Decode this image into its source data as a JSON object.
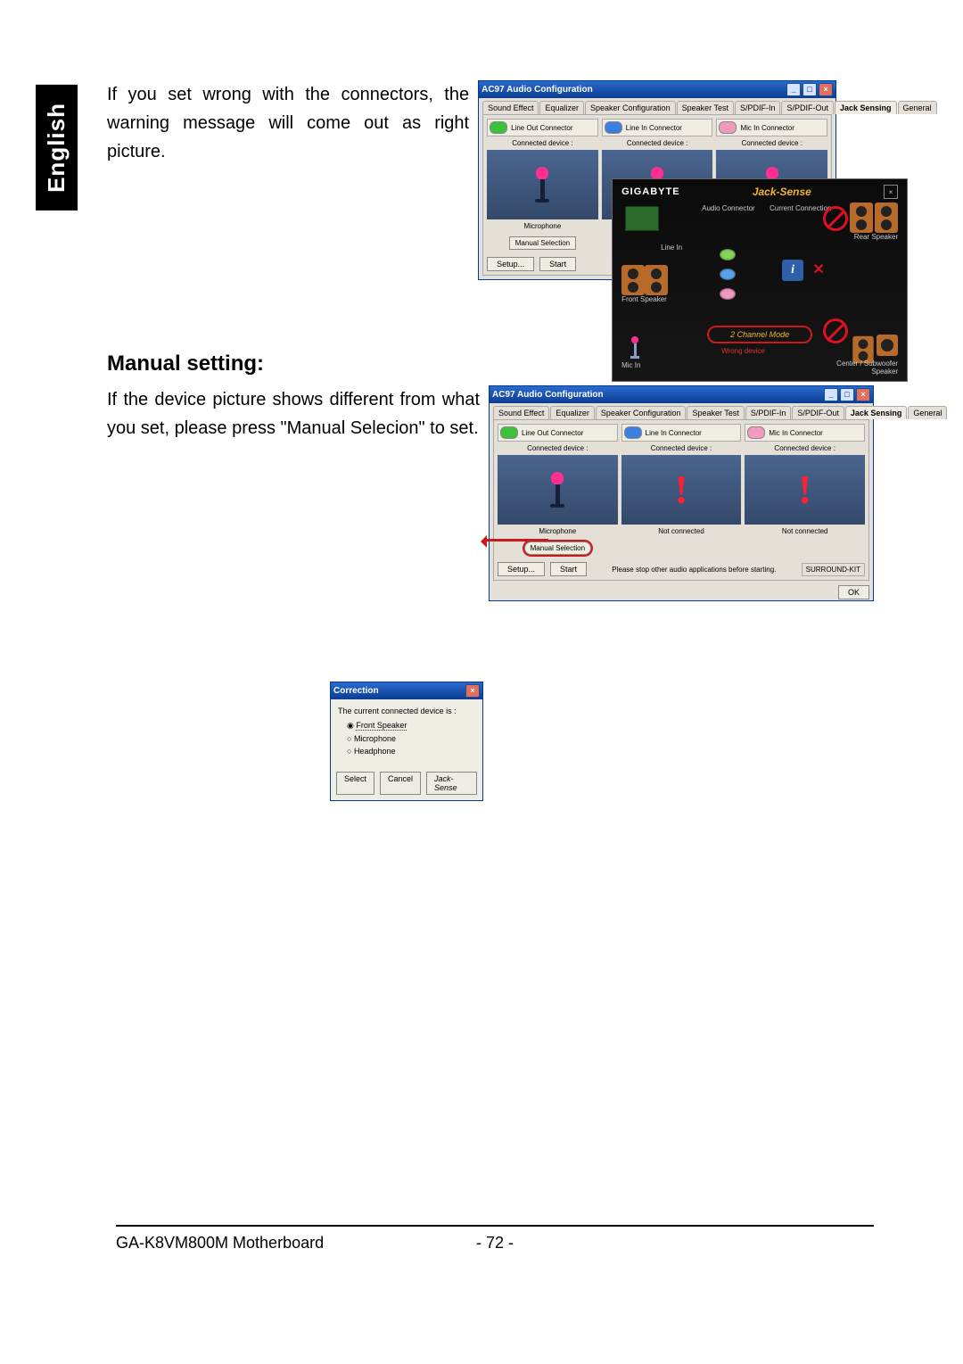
{
  "language_tab": "English",
  "section1": {
    "text": "If you set wrong with the connectors, the warning message will come out as right picture."
  },
  "section2": {
    "heading": "Manual setting:",
    "text": "If the device picture shows different from what you set, please press \"Manual Selecion\" to set."
  },
  "ac97_window": {
    "title": "AC97 Audio Configuration",
    "tabs": [
      "Sound Effect",
      "Equalizer",
      "Speaker Configuration",
      "Speaker Test",
      "S/PDIF-In",
      "S/PDIF-Out",
      "Jack Sensing",
      "General"
    ],
    "active_tab": "Jack Sensing",
    "connectors": {
      "line_out": {
        "label": "Line Out Connector",
        "sub": "Connected device :",
        "device": "Microphone"
      },
      "line_in": {
        "label": "Line In Connector",
        "sub": "Connected device :",
        "device": ""
      },
      "mic_in": {
        "label": "Mic In Connector",
        "sub": "Connected device :",
        "device": ""
      }
    },
    "manual_button": "Manual Selection",
    "setup_button": "Setup...",
    "start_button": "Start"
  },
  "jack_sense": {
    "logo": "GIGABYTE",
    "title": "Jack-Sense",
    "labels": {
      "audio_connector": "Audio Connector",
      "current_connection": "Current Connection",
      "rear_speaker": "Rear Speaker",
      "front_speaker": "Front Speaker",
      "line_in": "Line In",
      "mic_in": "Mic In",
      "center_sub": "Center / Subwoofer Speaker",
      "mode": "2 Channel Mode",
      "wrong": "Wrong device"
    }
  },
  "ac97_window2": {
    "title": "AC97 Audio Configuration",
    "tabs": [
      "Sound Effect",
      "Equalizer",
      "Speaker Configuration",
      "Speaker Test",
      "S/PDIF-In",
      "S/PDIF-Out",
      "Jack Sensing",
      "General"
    ],
    "active_tab": "Jack Sensing",
    "connectors": {
      "line_out": {
        "label": "Line Out Connector",
        "sub": "Connected device :",
        "device": "Microphone"
      },
      "line_in": {
        "label": "Line In Connector",
        "sub": "Connected device :",
        "device": "Not connected"
      },
      "mic_in": {
        "label": "Mic In Connector",
        "sub": "Connected device :",
        "device": "Not connected"
      }
    },
    "manual_button": "Manual Selection",
    "setup_button": "Setup...",
    "start_button": "Start",
    "note": "Please stop other audio applications before starting.",
    "surround": "SURROUND-KIT",
    "ok": "OK"
  },
  "correction_dialog": {
    "title": "Correction",
    "prompt": "The current connected device is :",
    "options": [
      "Front Speaker",
      "Microphone",
      "Headphone"
    ],
    "selected": "Front Speaker",
    "buttons": {
      "select": "Select",
      "cancel": "Cancel",
      "jack_sense": "Jack-Sense"
    }
  },
  "footer": {
    "product": "GA-K8VM800M Motherboard",
    "page": "- 72 -"
  }
}
